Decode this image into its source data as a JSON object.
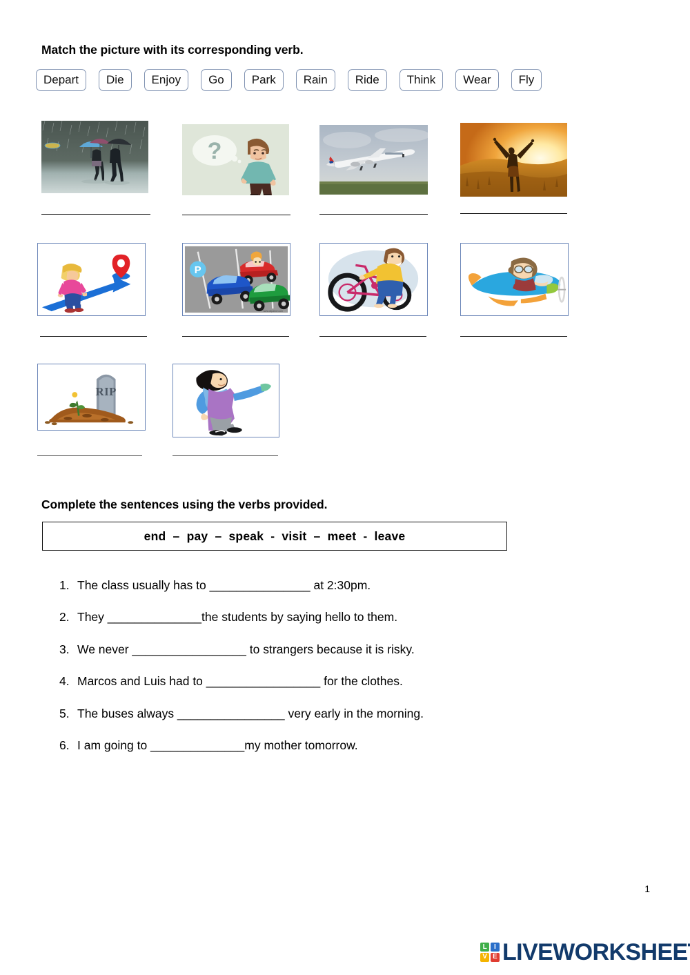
{
  "sections": {
    "matching": {
      "title": "Match the picture with its corresponding verb.",
      "verbs": [
        {
          "label": "Depart"
        },
        {
          "label": "Die"
        },
        {
          "label": "Enjoy"
        },
        {
          "label": "Go"
        },
        {
          "label": "Park"
        },
        {
          "label": "Rain"
        },
        {
          "label": "Ride"
        },
        {
          "label": "Think"
        },
        {
          "label": "Wear"
        },
        {
          "label": "Fly"
        }
      ],
      "pictures": [
        {
          "id": "rain-photo",
          "alt": "Two people walking with umbrellas in heavy rain",
          "type": "photo",
          "answer": ""
        },
        {
          "id": "think-clipart",
          "alt": "Boy with question mark thought bubble thinking",
          "type": "clipart",
          "answer": ""
        },
        {
          "id": "depart-photo",
          "alt": "Air France airplane taking off",
          "type": "photo",
          "answer": ""
        },
        {
          "id": "enjoy-photo",
          "alt": "Woman with arms raised at sunset in a field",
          "type": "photo",
          "answer": ""
        },
        {
          "id": "go-clipart",
          "alt": "Child walking along blue arrow toward map pin",
          "type": "clipart",
          "answer": ""
        },
        {
          "id": "park-clipart",
          "alt": "Cars parking in a parking lot with P sign",
          "type": "clipart",
          "answer": ""
        },
        {
          "id": "ride-clipart",
          "alt": "Boy riding a bicycle",
          "type": "clipart",
          "answer": ""
        },
        {
          "id": "fly-clipart",
          "alt": "Pilot flying a small blue airplane",
          "type": "clipart",
          "answer": ""
        },
        {
          "id": "die-clipart",
          "alt": "Grave with RIP headstone and flower",
          "type": "clipart",
          "answer": ""
        },
        {
          "id": "wear-clipart",
          "alt": "Person putting on a blue jacket",
          "type": "clipart",
          "answer": ""
        }
      ]
    },
    "completion": {
      "title": "Complete the sentences using the verbs provided.",
      "wordbank": "end  –  pay  –  speak  -  visit  –  meet  -  leave",
      "wordbank_items": [
        "end",
        "pay",
        "speak",
        "visit",
        "meet",
        "leave"
      ],
      "sentences": [
        {
          "number": "1.",
          "text": "The class usually has to _______________ at 2:30pm."
        },
        {
          "number": "2.",
          "text": "They ______________the students by saying hello to them."
        },
        {
          "number": "3.",
          "text": "We never _________________ to strangers because it is risky."
        },
        {
          "number": "4.",
          "text": "Marcos and Luis had to _________________ for the clothes."
        },
        {
          "number": "5.",
          "text": "The buses always ________________ very early in the morning."
        },
        {
          "number": "6.",
          "text": "I am going to ______________my mother tomorrow."
        }
      ]
    }
  },
  "footer": {
    "page_number": "1",
    "brand": "LIVEWORKSHEETS",
    "logo_letters": [
      "L",
      "I",
      "V",
      "E"
    ],
    "logo_colors": [
      "#3fae49",
      "#2a6fc9",
      "#f4b400",
      "#e03c31"
    ]
  }
}
